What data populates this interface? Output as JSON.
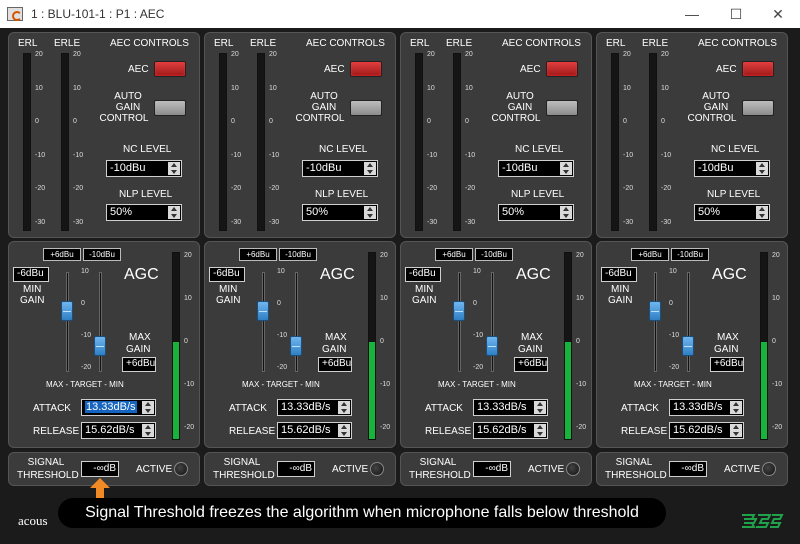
{
  "window": {
    "title": "1 : BLU-101-1 : P1 : AEC",
    "minimize_glyph": "—",
    "maximize_glyph": "☐",
    "close_glyph": "✕",
    "app_icon": "app-logo-icon"
  },
  "channels": [
    {
      "aec": {
        "erl_label": "ERL",
        "erle_label": "ERLE",
        "controls_title": "AEC CONTROLS",
        "aec_label": "AEC",
        "aec_on": true,
        "agc_label_1": "AUTO",
        "agc_label_2": "GAIN",
        "agc_label_3": "CONTROL",
        "agc_on": false,
        "nc_level_label": "NC LEVEL",
        "nc_level_value": "-10dBu",
        "nlp_level_label": "NLP LEVEL",
        "nlp_level_value": "50%"
      },
      "agc": {
        "title": "AGC",
        "max_target_box_1": "+6dBu",
        "max_target_box_2": "-10dBu",
        "min_gain_value": "-6dBu",
        "min_gain_label_1": "MIN",
        "min_gain_label_2": "GAIN",
        "max_gain_label_1": "MAX",
        "max_gain_label_2": "GAIN",
        "max_gain_value": "+6dBu",
        "slider_caption": "MAX - TARGET - MIN",
        "attack_label": "ATTACK",
        "attack_value": "13.33dB/s",
        "release_label": "RELEASE",
        "release_value": "15.62dB/s"
      },
      "threshold": {
        "label_1": "SIGNAL",
        "label_2": "THRESHOLD",
        "value": "-∞dB",
        "active_label": "ACTIVE"
      }
    },
    {
      "aec": {
        "erl_label": "ERL",
        "erle_label": "ERLE",
        "controls_title": "AEC CONTROLS",
        "aec_label": "AEC",
        "aec_on": true,
        "agc_label_1": "AUTO",
        "agc_label_2": "GAIN",
        "agc_label_3": "CONTROL",
        "agc_on": false,
        "nc_level_label": "NC LEVEL",
        "nc_level_value": "-10dBu",
        "nlp_level_label": "NLP LEVEL",
        "nlp_level_value": "50%"
      },
      "agc": {
        "title": "AGC",
        "max_target_box_1": "+6dBu",
        "max_target_box_2": "-10dBu",
        "min_gain_value": "-6dBu",
        "min_gain_label_1": "MIN",
        "min_gain_label_2": "GAIN",
        "max_gain_label_1": "MAX",
        "max_gain_label_2": "GAIN",
        "max_gain_value": "+6dBu",
        "slider_caption": "MAX - TARGET - MIN",
        "attack_label": "ATTACK",
        "attack_value": "13.33dB/s",
        "release_label": "RELEASE",
        "release_value": "15.62dB/s"
      },
      "threshold": {
        "label_1": "SIGNAL",
        "label_2": "THRESHOLD",
        "value": "-∞dB",
        "active_label": "ACTIVE"
      }
    },
    {
      "aec": {
        "erl_label": "ERL",
        "erle_label": "ERLE",
        "controls_title": "AEC CONTROLS",
        "aec_label": "AEC",
        "aec_on": true,
        "agc_label_1": "AUTO",
        "agc_label_2": "GAIN",
        "agc_label_3": "CONTROL",
        "agc_on": false,
        "nc_level_label": "NC LEVEL",
        "nc_level_value": "-10dBu",
        "nlp_level_label": "NLP LEVEL",
        "nlp_level_value": "50%"
      },
      "agc": {
        "title": "AGC",
        "max_target_box_1": "+6dBu",
        "max_target_box_2": "-10dBu",
        "min_gain_value": "-6dBu",
        "min_gain_label_1": "MIN",
        "min_gain_label_2": "GAIN",
        "max_gain_label_1": "MAX",
        "max_gain_label_2": "GAIN",
        "max_gain_value": "+6dBu",
        "slider_caption": "MAX - TARGET - MIN",
        "attack_label": "ATTACK",
        "attack_value": "13.33dB/s",
        "release_label": "RELEASE",
        "release_value": "15.62dB/s"
      },
      "threshold": {
        "label_1": "SIGNAL",
        "label_2": "THRESHOLD",
        "value": "-∞dB",
        "active_label": "ACTIVE"
      }
    },
    {
      "aec": {
        "erl_label": "ERL",
        "erle_label": "ERLE",
        "controls_title": "AEC CONTROLS",
        "aec_label": "AEC",
        "aec_on": true,
        "agc_label_1": "AUTO",
        "agc_label_2": "GAIN",
        "agc_label_3": "CONTROL",
        "agc_on": false,
        "nc_level_label": "NC LEVEL",
        "nc_level_value": "-10dBu",
        "nlp_level_label": "NLP LEVEL",
        "nlp_level_value": "50%"
      },
      "agc": {
        "title": "AGC",
        "max_target_box_1": "+6dBu",
        "max_target_box_2": "-10dBu",
        "min_gain_value": "-6dBu",
        "min_gain_label_1": "MIN",
        "min_gain_label_2": "GAIN",
        "max_gain_label_1": "MAX",
        "max_gain_label_2": "GAIN",
        "max_gain_value": "+6dBu",
        "slider_caption": "MAX - TARGET - MIN",
        "attack_label": "ATTACK",
        "attack_value": "13.33dB/s",
        "release_label": "RELEASE",
        "release_value": "15.62dB/s"
      },
      "threshold": {
        "label_1": "SIGNAL",
        "label_2": "THRESHOLD",
        "value": "-∞dB",
        "active_label": "ACTIVE"
      }
    }
  ],
  "aec_scale": [
    "20",
    "10",
    "0",
    "-10",
    "-20",
    "-30"
  ],
  "agc_slider_scale": [
    "10",
    "0",
    "-10",
    "-20"
  ],
  "agc_meter_scale": [
    "20",
    "10",
    "0",
    "-10",
    "-20"
  ],
  "agc_meter_level": 0.52,
  "min_gain_slider_position": -6,
  "max_gain_slider_position": -10,
  "tooltip": "Signal Threshold freezes the algorithm when microphone falls below threshold",
  "brand_text": "acous",
  "logo_icon": "bss-logo-icon",
  "colors": {
    "aec_on": "#c62828",
    "button_off": "#9e9e9e",
    "slider_knob": "#4a9ae0",
    "meter_fill": "#17b33a",
    "arrow": "#f08a24"
  }
}
